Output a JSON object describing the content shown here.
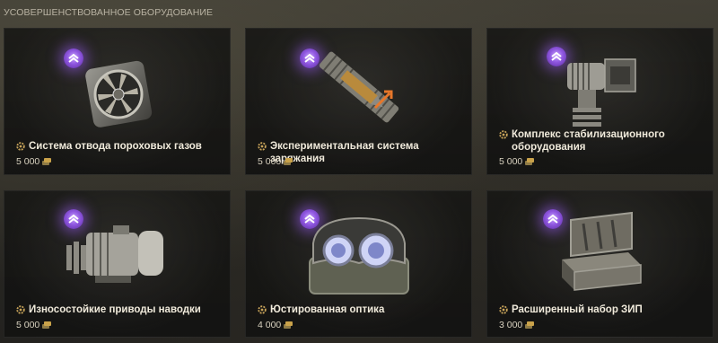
{
  "section_title": "УСОВЕРШЕНСТВОВАННОЕ ОБОРУДОВАНИЕ",
  "items": [
    {
      "name": "Система отвода пороховых газов",
      "price": "5 000",
      "icon": "gas-exhaust-fan-icon"
    },
    {
      "name": "Экспериментальная система заряжания",
      "price": "5 000",
      "icon": "loading-system-shell-icon"
    },
    {
      "name": "Комплекс стабилизационного оборудования",
      "price": "5 000",
      "icon": "stabilizer-gearbox-icon"
    },
    {
      "name": "Износостойкие приводы наводки",
      "price": "5 000",
      "icon": "electric-motor-drive-icon"
    },
    {
      "name": "Юстированная оптика",
      "price": "4 000",
      "icon": "binocular-optics-icon"
    },
    {
      "name": "Расширенный набор ЗИП",
      "price": "3 000",
      "icon": "toolbox-icon"
    }
  ],
  "colors": {
    "badge_purple": "#9b63ea",
    "credit_gold": "#c9a24a"
  }
}
